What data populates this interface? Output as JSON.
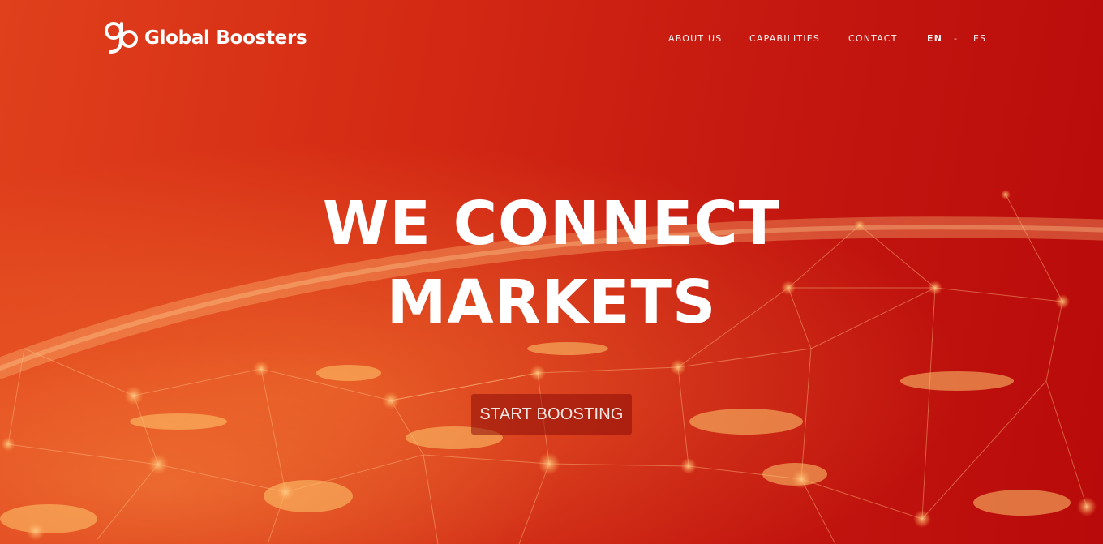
{
  "brand": {
    "name": "Global Boosters",
    "logo_icon": "gb-monogram-logo"
  },
  "nav": {
    "items": [
      {
        "label": "ABOUT US"
      },
      {
        "label": "CAPABILITIES"
      },
      {
        "label": "CONTACT"
      }
    ],
    "languages": {
      "current": "EN",
      "separator": "-",
      "other": "ES"
    }
  },
  "hero": {
    "headline_line1": "WE CONNECT",
    "headline_line2": "MARKETS",
    "cta_label": "START BOOSTING",
    "background": "red-earth-network-image"
  },
  "colors": {
    "brand_red": "#c8180b",
    "brand_orange": "#e0401c",
    "text": "#ffffff"
  }
}
